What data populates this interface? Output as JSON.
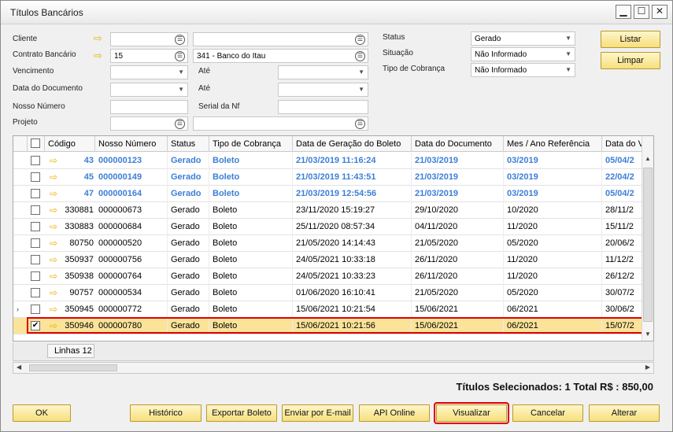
{
  "window": {
    "title": "Títulos Bancários"
  },
  "controls": {
    "minimize": "▁",
    "maximize": "☐",
    "close": "✕"
  },
  "filters": {
    "cliente_label": "Cliente",
    "contrato_label": "Contrato Bancário",
    "contrato_value": "15",
    "contrato_desc": "341 - Banco do Itau",
    "vencimento_label": "Vencimento",
    "ate1_label": "Até",
    "data_doc_label": "Data do Documento",
    "ate2_label": "Até",
    "nosso_numero_label": "Nosso Número",
    "serial_label": "Serial da Nf",
    "projeto_label": "Projeto",
    "status_label": "Status",
    "status_value": "Gerado",
    "situacao_label": "Situação",
    "situacao_value": "Não Informado",
    "tipo_label": "Tipo de Cobrança",
    "tipo_value": "Não Informado"
  },
  "buttons": {
    "listar": "Listar",
    "limpar": "Limpar",
    "ok": "OK",
    "historico": "Histórico",
    "exportar": "Exportar Boleto",
    "email": "Enviar por E-mail",
    "api": "API Online",
    "visualizar": "Visualizar",
    "cancelar": "Cancelar",
    "alterar": "Alterar"
  },
  "grid": {
    "headers": [
      "Código",
      "Nosso Número",
      "Status",
      "Tipo de Cobrança",
      "Data de Geração do Boleto",
      "Data do Documento",
      "Mes / Ano Referência",
      "Data do Venc"
    ],
    "rows": [
      {
        "codigo": "43",
        "nosso": "000000123",
        "status": "Gerado",
        "tipo": "Boleto",
        "geracao": "21/03/2019 11:16:24",
        "doc": "21/03/2019",
        "ref": "03/2019",
        "venc": "05/04/2",
        "blue": true,
        "checked": false
      },
      {
        "codigo": "45",
        "nosso": "000000149",
        "status": "Gerado",
        "tipo": "Boleto",
        "geracao": "21/03/2019 11:43:51",
        "doc": "21/03/2019",
        "ref": "03/2019",
        "venc": "22/04/2",
        "blue": true,
        "checked": false
      },
      {
        "codigo": "47",
        "nosso": "000000164",
        "status": "Gerado",
        "tipo": "Boleto",
        "geracao": "21/03/2019 12:54:56",
        "doc": "21/03/2019",
        "ref": "03/2019",
        "venc": "05/04/2",
        "blue": true,
        "checked": false
      },
      {
        "codigo": "330881",
        "nosso": "000000673",
        "status": "Gerado",
        "tipo": "Boleto",
        "geracao": "23/11/2020 15:19:27",
        "doc": "29/10/2020",
        "ref": "10/2020",
        "venc": "28/11/2",
        "blue": false,
        "checked": false
      },
      {
        "codigo": "330883",
        "nosso": "000000684",
        "status": "Gerado",
        "tipo": "Boleto",
        "geracao": "25/11/2020 08:57:34",
        "doc": "04/11/2020",
        "ref": "11/2020",
        "venc": "15/11/2",
        "blue": false,
        "checked": false
      },
      {
        "codigo": "80750",
        "nosso": "000000520",
        "status": "Gerado",
        "tipo": "Boleto",
        "geracao": "21/05/2020 14:14:43",
        "doc": "21/05/2020",
        "ref": "05/2020",
        "venc": "20/06/2",
        "blue": false,
        "checked": false
      },
      {
        "codigo": "350937",
        "nosso": "000000756",
        "status": "Gerado",
        "tipo": "Boleto",
        "geracao": "24/05/2021 10:33:18",
        "doc": "26/11/2020",
        "ref": "11/2020",
        "venc": "11/12/2",
        "blue": false,
        "checked": false
      },
      {
        "codigo": "350938",
        "nosso": "000000764",
        "status": "Gerado",
        "tipo": "Boleto",
        "geracao": "24/05/2021 10:33:23",
        "doc": "26/11/2020",
        "ref": "11/2020",
        "venc": "26/12/2",
        "blue": false,
        "checked": false
      },
      {
        "codigo": "90757",
        "nosso": "000000534",
        "status": "Gerado",
        "tipo": "Boleto",
        "geracao": "01/06/2020 16:10:41",
        "doc": "21/05/2020",
        "ref": "05/2020",
        "venc": "30/07/2",
        "blue": false,
        "checked": false
      },
      {
        "codigo": "350945",
        "nosso": "000000772",
        "status": "Gerado",
        "tipo": "Boleto",
        "geracao": "15/06/2021 10:21:54",
        "doc": "15/06/2021",
        "ref": "06/2021",
        "venc": "30/06/2",
        "blue": false,
        "checked": false
      },
      {
        "codigo": "350946",
        "nosso": "000000780",
        "status": "Gerado",
        "tipo": "Boleto",
        "geracao": "15/06/2021 10:21:56",
        "doc": "15/06/2021",
        "ref": "06/2021",
        "venc": "15/07/2",
        "blue": false,
        "checked": true
      }
    ],
    "linhas_label": "Linhas 12"
  },
  "summary": {
    "text": "Títulos Selecionados: 1 Total R$ :  850,00"
  }
}
